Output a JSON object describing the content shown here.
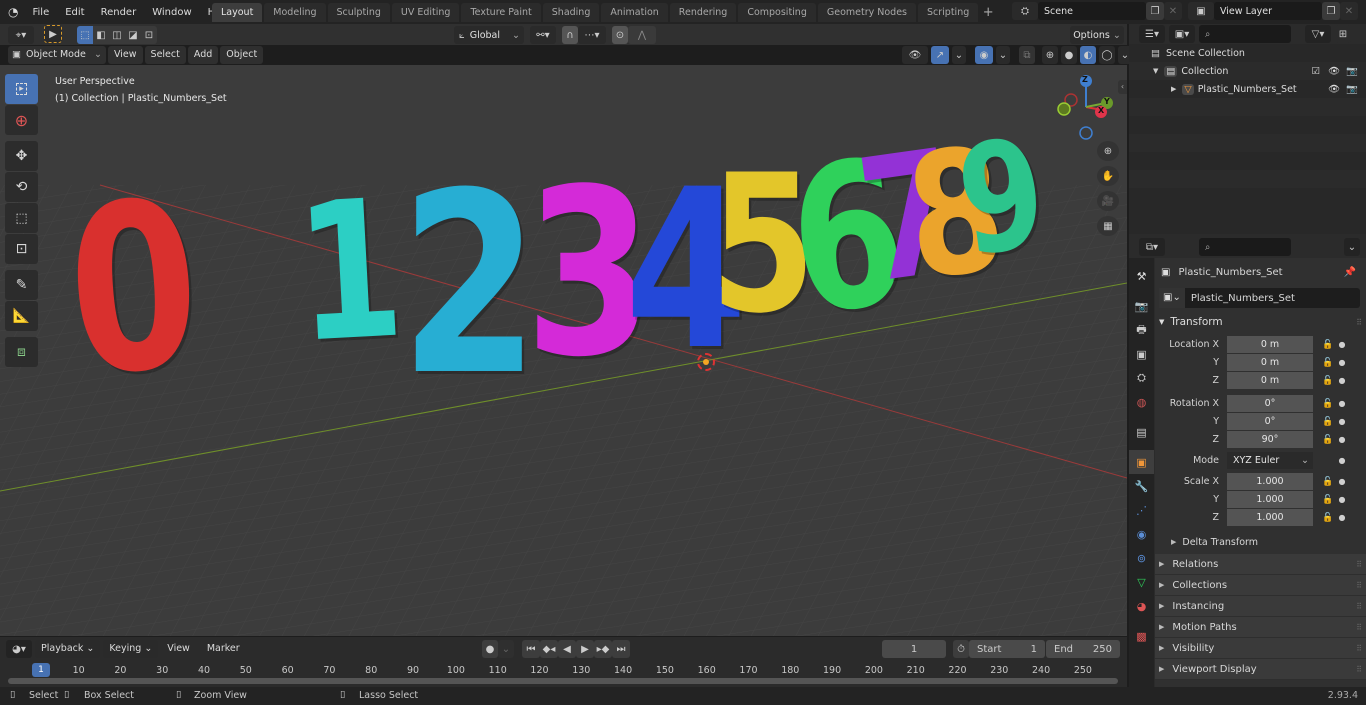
{
  "topbar": {
    "menu": [
      "File",
      "Edit",
      "Render",
      "Window",
      "Help"
    ],
    "workspaces": [
      "Layout",
      "Modeling",
      "Sculpting",
      "UV Editing",
      "Texture Paint",
      "Shading",
      "Animation",
      "Rendering",
      "Compositing",
      "Geometry Nodes",
      "Scripting"
    ],
    "active_workspace": "Layout",
    "add_workspace": "+",
    "scene": "Scene",
    "view_layer": "View Layer"
  },
  "tool_header": {
    "transform_orientation": "Global",
    "options": "Options"
  },
  "viewport_header": {
    "mode": "Object Mode",
    "menus": [
      "View",
      "Select",
      "Add",
      "Object"
    ]
  },
  "viewport": {
    "perspective": "User Perspective",
    "collection_info": "(1) Collection | Plastic_Numbers_Set",
    "digits": [
      {
        "char": "0",
        "color": "#d9302e"
      },
      {
        "char": "1",
        "color": "#2ccfc4"
      },
      {
        "char": "2",
        "color": "#27aed3"
      },
      {
        "char": "3",
        "color": "#d42ad8"
      },
      {
        "char": "4",
        "color": "#2448d8"
      },
      {
        "char": "5",
        "color": "#e3c62a"
      },
      {
        "char": "6",
        "color": "#2fd15b"
      },
      {
        "char": "7",
        "color": "#9332d6"
      },
      {
        "char": "8",
        "color": "#eba42c"
      },
      {
        "char": "9",
        "color": "#2cc48c"
      }
    ],
    "gizmo": {
      "x": "X",
      "y": "Y",
      "z": "Z"
    }
  },
  "outliner": {
    "root": "Scene Collection",
    "collection": "Collection",
    "object": "Plastic_Numbers_Set"
  },
  "properties": {
    "object_name": "Plastic_Numbers_Set",
    "datablock": "Plastic_Numbers_Set",
    "transform_title": "Transform",
    "location_label": "Location X",
    "rotation_label": "Rotation X",
    "scale_label": "Scale X",
    "y": "Y",
    "z": "Z",
    "location": [
      "0 m",
      "0 m",
      "0 m"
    ],
    "rotation": [
      "0°",
      "0°",
      "90°"
    ],
    "mode_label": "Mode",
    "mode": "XYZ Euler",
    "scale": [
      "1.000",
      "1.000",
      "1.000"
    ],
    "delta": "Delta Transform",
    "panels": [
      "Relations",
      "Collections",
      "Instancing",
      "Motion Paths",
      "Visibility",
      "Viewport Display"
    ]
  },
  "timeline": {
    "menus": [
      "Playback",
      "Keying",
      "View",
      "Marker"
    ],
    "current_frame": "1",
    "start_label": "Start",
    "start": "1",
    "end_label": "End",
    "end": "250",
    "ticks": [
      "10",
      "20",
      "30",
      "40",
      "50",
      "60",
      "70",
      "80",
      "90",
      "100",
      "110",
      "120",
      "130",
      "140",
      "150",
      "160",
      "170",
      "180",
      "190",
      "200",
      "210",
      "220",
      "230",
      "240",
      "250"
    ]
  },
  "statusbar": {
    "select": "Select",
    "box_select": "Box Select",
    "zoom_view": "Zoom View",
    "lasso_select": "Lasso Select",
    "version": "2.93.4"
  }
}
